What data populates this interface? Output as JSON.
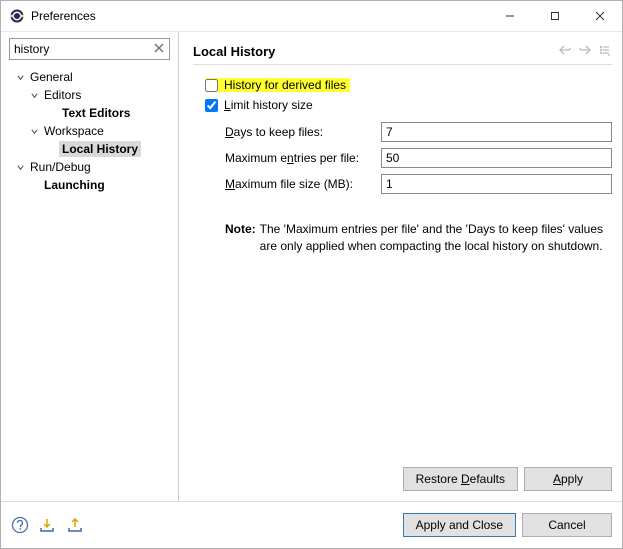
{
  "window": {
    "title": "Preferences"
  },
  "filter": {
    "value": "history"
  },
  "tree": {
    "general": "General",
    "editors": "Editors",
    "text_editors": "Text Editors",
    "workspace": "Workspace",
    "local_history": "Local History",
    "run_debug": "Run/Debug",
    "launching": "Launching"
  },
  "panel": {
    "title": "Local History",
    "chk_derived": "History for derived files",
    "chk_limit_prefix": "L",
    "chk_limit_rest": "imit history size",
    "days_label_prefix": "D",
    "days_label_rest": "ays to keep files:",
    "days_value": "7",
    "max_entries_label_pre": "Maximum e",
    "max_entries_label_u": "n",
    "max_entries_label_post": "tries per file:",
    "max_entries_value": "50",
    "max_size_label_u": "M",
    "max_size_label_rest": "aximum file size (MB):",
    "max_size_value": "1",
    "note_label": "Note:",
    "note_text": "The 'Maximum entries per file' and the 'Days to keep files' values are only applied when compacting the local history on shutdown."
  },
  "buttons": {
    "restore_pre": "Restore ",
    "restore_u": "D",
    "restore_post": "efaults",
    "apply_u": "A",
    "apply_rest": "pply",
    "apply_close": "Apply and Close",
    "cancel": "Cancel"
  }
}
